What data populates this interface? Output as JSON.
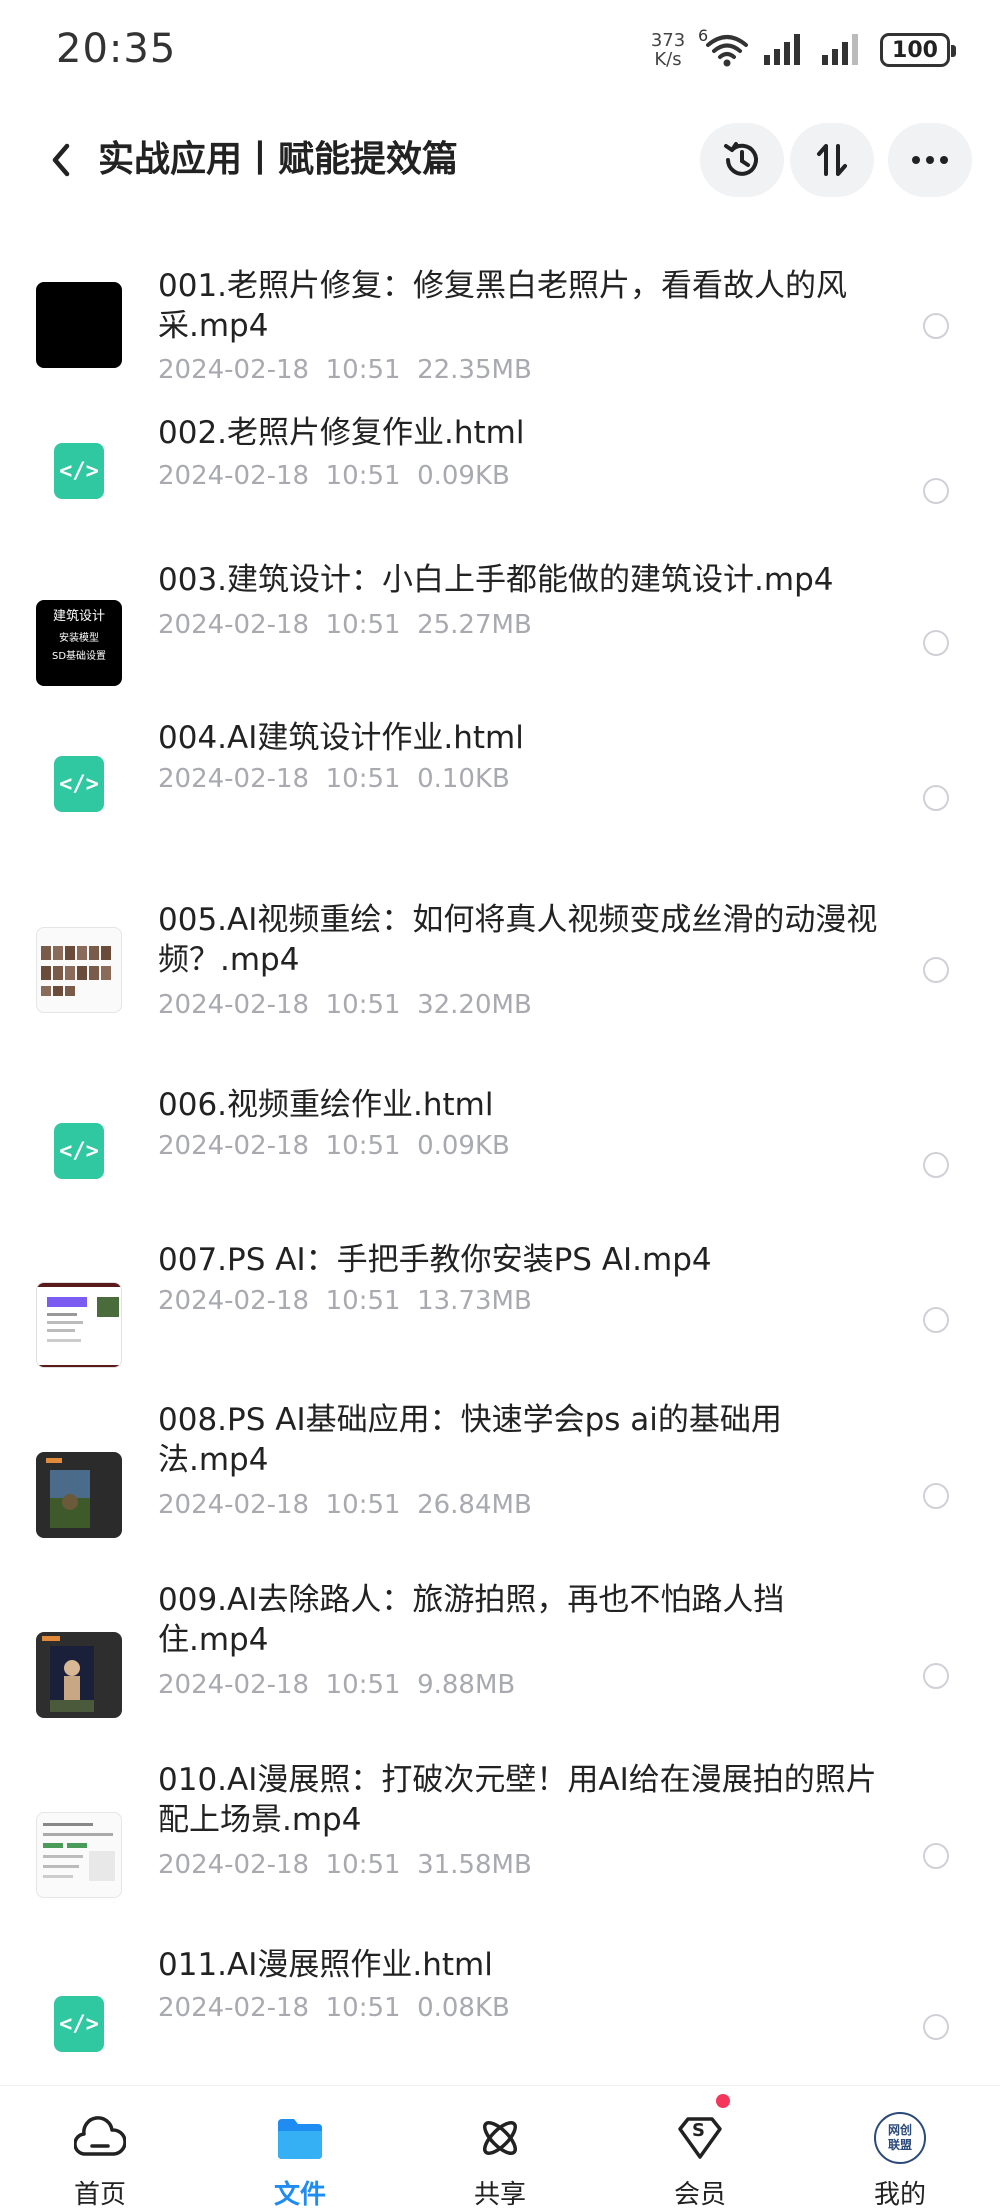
{
  "status_bar": {
    "time": "20:35",
    "net_speed_value": "373",
    "net_speed_unit": "K/s",
    "wifi_badge": "6",
    "battery": "100"
  },
  "header": {
    "title": "实战应用丨赋能提效篇"
  },
  "files": [
    {
      "name": "001.老照片修复：修复黑白老照片，看看故人的风采.mp4",
      "meta": "2024-02-18  10:51  22.35MB",
      "thumb": "black"
    },
    {
      "name": "002.老照片修复作业.html",
      "meta": "2024-02-18  10:51  0.09KB",
      "thumb": "html"
    },
    {
      "name": "003.建筑设计：小白上手都能做的建筑设计.mp4",
      "meta": "2024-02-18  10:51  25.27MB",
      "thumb": "arch",
      "thumb_lines": [
        "建筑设计",
        "安装模型",
        "SD基础设置"
      ]
    },
    {
      "name": "004.AI建筑设计作业.html",
      "meta": "2024-02-18  10:51  0.10KB",
      "thumb": "html"
    },
    {
      "name": "005.AI视频重绘：如何将真人视频变成丝滑的动漫视频？.mp4",
      "meta": "2024-02-18  10:51  32.20MB",
      "thumb": "video-grid"
    },
    {
      "name": "006.视频重绘作业.html",
      "meta": "2024-02-18  10:51  0.09KB",
      "thumb": "html"
    },
    {
      "name": "007.PS AI：手把手教你安装PS AI.mp4",
      "meta": "2024-02-18  10:51  13.73MB",
      "thumb": "ps-install"
    },
    {
      "name": "008.PS AI基础应用：快速学会ps ai的基础用法.mp4",
      "meta": "2024-02-18  10:51  26.84MB",
      "thumb": "ps-dark"
    },
    {
      "name": "009.AI去除路人：旅游拍照，再也不怕路人挡住.mp4",
      "meta": "2024-02-18  10:51  9.88MB",
      "thumb": "ps-dark2"
    },
    {
      "name": "010.AI漫展照：打破次元壁！用AI给在漫展拍的照片配上场景.mp4",
      "meta": "2024-02-18  10:51  31.58MB",
      "thumb": "doc"
    },
    {
      "name": "011.AI漫展照作业.html",
      "meta": "2024-02-18  10:51  0.08KB",
      "thumb": "html"
    }
  ],
  "html_icon_text": "</>",
  "bottom_nav": [
    {
      "label": "首页",
      "icon": "home-cloud-icon",
      "active": false
    },
    {
      "label": "文件",
      "icon": "folder-icon",
      "active": true
    },
    {
      "label": "共享",
      "icon": "share-atom-icon",
      "active": false
    },
    {
      "label": "会员",
      "icon": "vip-diamond-icon",
      "active": false
    },
    {
      "label": "我的",
      "icon": "profile-avatar-icon",
      "active": false
    }
  ],
  "avatar_text": [
    "网创",
    "联盟"
  ],
  "vip_icon_text": "S",
  "colors": {
    "accent": "#1e8cf0",
    "html_icon": "#2fc8a1",
    "meta_text": "#a8aab0",
    "badge_red": "#f5365c"
  }
}
